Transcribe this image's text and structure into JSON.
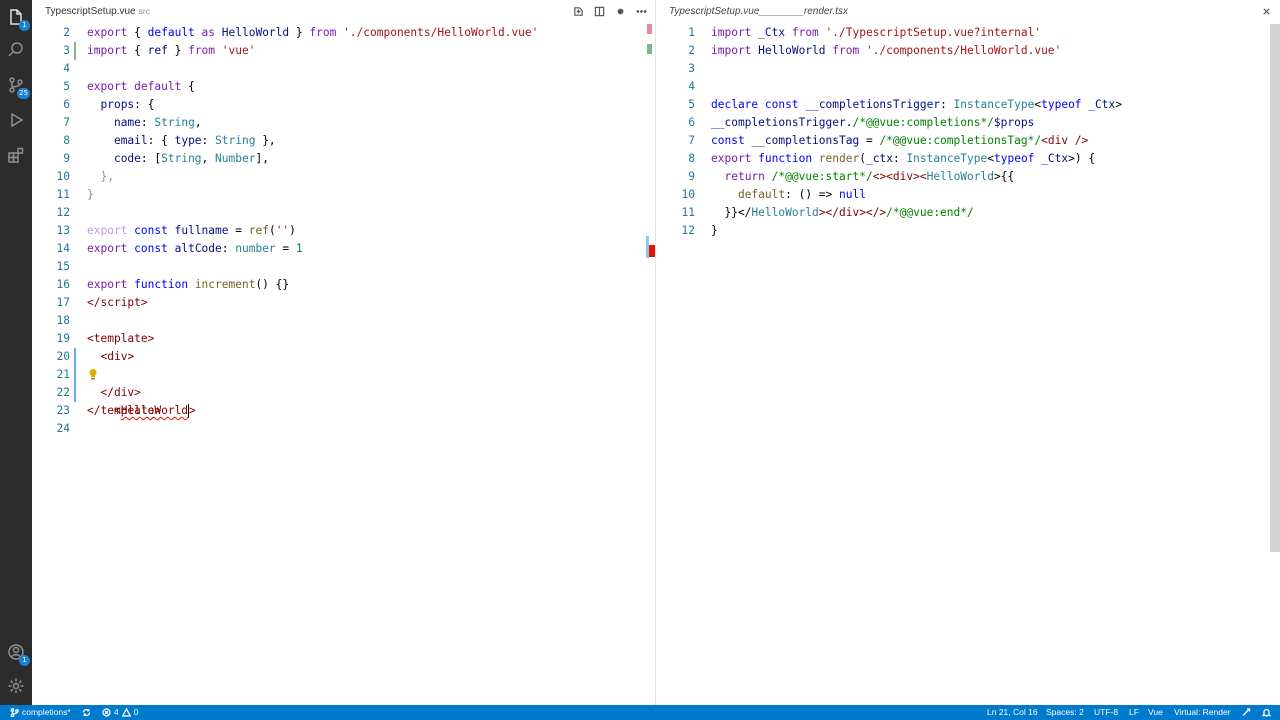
{
  "activity_bar": {
    "items": [
      {
        "icon": "files-icon",
        "badge": "1"
      },
      {
        "icon": "search-icon",
        "badge": ""
      },
      {
        "icon": "source-control-icon",
        "badge": "25"
      },
      {
        "icon": "run-debug-icon",
        "badge": ""
      },
      {
        "icon": "extensions-icon",
        "badge": ""
      }
    ],
    "bottom": [
      {
        "icon": "account-icon",
        "badge": "1"
      },
      {
        "icon": "gear-icon",
        "badge": ""
      }
    ]
  },
  "left_editor": {
    "tab": {
      "title": "TypescriptSetup.vue",
      "description": "src"
    },
    "lines": [
      {
        "n": "2"
      },
      {
        "n": "3"
      },
      {
        "n": "4"
      },
      {
        "n": "5"
      },
      {
        "n": "6"
      },
      {
        "n": "7"
      },
      {
        "n": "8"
      },
      {
        "n": "9"
      },
      {
        "n": "10"
      },
      {
        "n": "11"
      },
      {
        "n": "12"
      },
      {
        "n": "13"
      },
      {
        "n": "14"
      },
      {
        "n": "15"
      },
      {
        "n": "16"
      },
      {
        "n": "17"
      },
      {
        "n": "18"
      },
      {
        "n": "19"
      },
      {
        "n": "20"
      },
      {
        "n": "21"
      },
      {
        "n": "22"
      },
      {
        "n": "23"
      },
      {
        "n": "24"
      }
    ],
    "code": {
      "l2": [
        "export",
        " { ",
        "default",
        " ",
        "as",
        " ",
        "HelloWorld",
        " } ",
        "from",
        " ",
        "'./components/HelloWorld.vue'"
      ],
      "l3": [
        "import",
        " { ",
        "ref",
        " } ",
        "from",
        " ",
        "'vue'"
      ],
      "l5": [
        "export",
        " ",
        "default",
        " {"
      ],
      "l6": [
        "  ",
        "props",
        ": {"
      ],
      "l7": [
        "    ",
        "name",
        ": ",
        "String",
        ","
      ],
      "l8": [
        "    ",
        "email",
        ": { ",
        "type",
        ": ",
        "String",
        " },"
      ],
      "l9": [
        "    ",
        "code",
        ": [",
        "String",
        ", ",
        "Number",
        "],"
      ],
      "l10": [
        "  },"
      ],
      "l11": [
        "}"
      ],
      "l13": [
        "export",
        " ",
        "const",
        " ",
        "fullname",
        " = ",
        "ref",
        "(",
        "''",
        ")"
      ],
      "l14": [
        "export",
        " ",
        "const",
        " ",
        "altCode",
        ": ",
        "number",
        " = ",
        "1"
      ],
      "l16": [
        "export",
        " ",
        "function",
        " ",
        "increment",
        "() {}"
      ],
      "l17": [
        "</",
        "script",
        ">"
      ],
      "l19": [
        "<",
        "template",
        ">"
      ],
      "l20": [
        "  <",
        "div",
        ">"
      ],
      "l21": [
        "    <",
        "HelloWorld",
        ">"
      ],
      "l22": [
        "  </",
        "div",
        ">"
      ],
      "l23": [
        "</",
        "template",
        ">"
      ]
    }
  },
  "right_editor": {
    "tab": {
      "title": "TypescriptSetup.vue________render.tsx"
    },
    "lines": [
      {
        "n": "1"
      },
      {
        "n": "2"
      },
      {
        "n": "3"
      },
      {
        "n": "4"
      },
      {
        "n": "5"
      },
      {
        "n": "6"
      },
      {
        "n": "7"
      },
      {
        "n": "8"
      },
      {
        "n": "9"
      },
      {
        "n": "10"
      },
      {
        "n": "11"
      },
      {
        "n": "12"
      }
    ],
    "code": {
      "l1": [
        "import",
        " _Ctx ",
        "from",
        " ",
        "'./TypescriptSetup.vue?internal'"
      ],
      "l2": [
        "import",
        " HelloWorld ",
        "from",
        " ",
        "'./components/HelloWorld.vue'"
      ],
      "l5": [
        "declare",
        " ",
        "const",
        " ",
        "__completionsTrigger",
        ": ",
        "InstanceType",
        "<",
        "typeof",
        " ",
        "_Ctx",
        ">"
      ],
      "l6": [
        "__completionsTrigger",
        ".",
        "/*@@vue:completions*/",
        "$props"
      ],
      "l7": [
        "const",
        " ",
        "__completionsTag",
        " = ",
        "/*@@vue:completionsTag*/",
        "<",
        "div",
        " />"
      ],
      "l8": [
        "export",
        " ",
        "function",
        " ",
        "render",
        "(",
        "_ctx",
        ": ",
        "InstanceType",
        "<",
        "typeof",
        " ",
        "_Ctx",
        ">) {"
      ],
      "l9": [
        "  ",
        "return",
        " ",
        "/*@@vue:start*/",
        "<><",
        "div",
        "><",
        "HelloWorld",
        ">{{"
      ],
      "l10": [
        "    ",
        "default",
        ": () => ",
        "null"
      ],
      "l11": [
        "  }}</",
        "HelloWorld",
        "></",
        "div",
        "></>",
        "/*@@vue:end*/"
      ],
      "l12": [
        "}"
      ]
    }
  },
  "statusbar": {
    "branch": "completions*",
    "sync": "",
    "errors": "4",
    "warnings": "0",
    "position": "Ln 21, Col 16",
    "spaces": "Spaces: 2",
    "encoding": "UTF-8",
    "eol": "LF",
    "language": "Vue",
    "virtual": "Virtual: Render"
  },
  "colors": {
    "accent": "#007acc",
    "activity_bar": "#2c2c2c",
    "line_number": "#237893",
    "modified_gutter": "#81b88b",
    "changed_gutter": "#66afe0",
    "error": "#e51400"
  }
}
